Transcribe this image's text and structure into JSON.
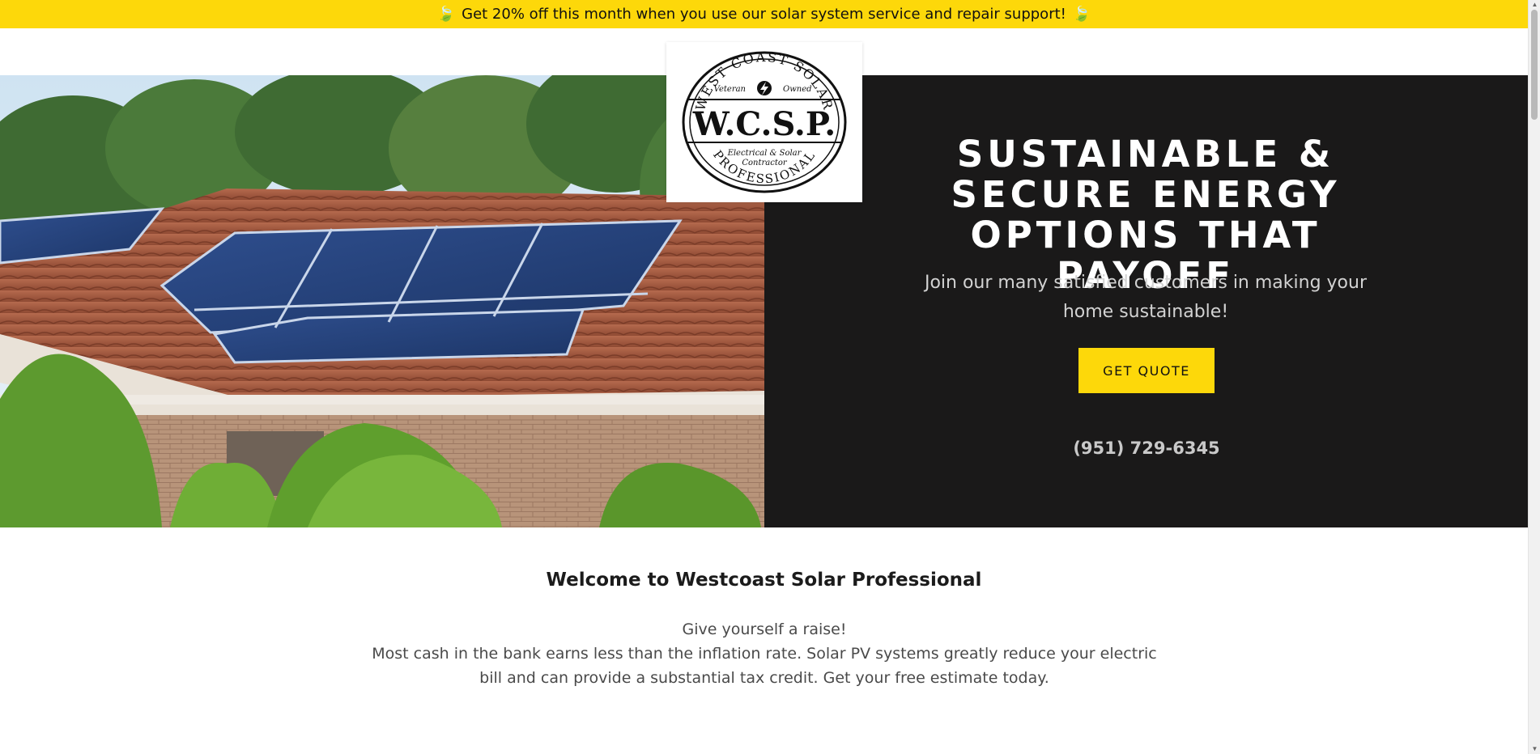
{
  "announcement": {
    "text": "Get 20% off this month when you use our solar system service and repair support!",
    "leaf_left": "🍃",
    "leaf_right": "🍃",
    "bg_color": "#fdd80a"
  },
  "logo": {
    "ring_top": "WEST COAST SOLAR",
    "ring_bottom": "PROFESSIONAL",
    "veteran_left": "Veteran",
    "veteran_right": "Owned",
    "monogram": "W.C.S.P.",
    "tagline_1": "Electrical & Solar",
    "tagline_2": "Contractor",
    "icon": "lightning-bolt-icon"
  },
  "hero": {
    "headline": "SUSTAINABLE & SECURE ENERGY OPTIONS THAT PAYOFF",
    "subline": "Join our many satisfied customers in making your home sustainable!",
    "cta_label": "GET QUOTE",
    "phone": "(951) 729-6345",
    "image_subject": "house-roof-solar-panels",
    "dark_bg": "#1a1919",
    "accent": "#fdd80a"
  },
  "welcome": {
    "title": "Welcome to Westcoast Solar Professional",
    "line_1": "Give yourself a raise!",
    "line_2": "Most cash in the bank earns less than the inflation rate. Solar PV systems greatly reduce your electric bill and can provide a substantial tax credit. Get your free estimate today."
  }
}
